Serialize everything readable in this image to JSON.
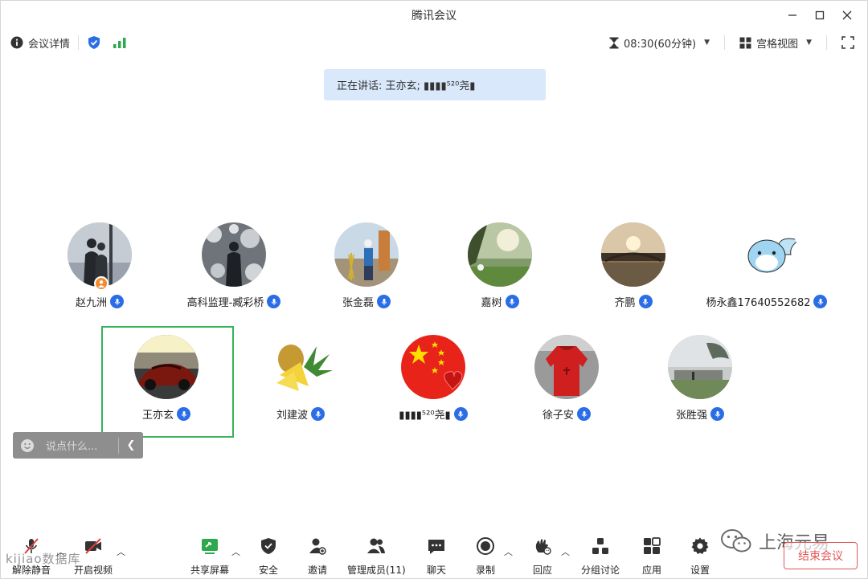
{
  "window": {
    "title": "腾讯会议"
  },
  "infobar": {
    "details_label": "会议详情",
    "timer": "08:30(60分钟)",
    "view_label": "宫格视图"
  },
  "speaking": {
    "text": "正在讲话: 王亦玄; ▮▮▮▮⁵²⁰尧▮"
  },
  "participants": [
    {
      "name": "赵九洲"
    },
    {
      "name": "高科监理-臧彩桥"
    },
    {
      "name": "张金磊"
    },
    {
      "name": "嘉树"
    },
    {
      "name": "齐鹏"
    },
    {
      "name": "杨永鑫17640552682"
    },
    {
      "name": "王亦玄"
    },
    {
      "name": "刘建波"
    },
    {
      "name": "▮▮▮▮⁵²⁰尧▮"
    },
    {
      "name": "徐子安"
    },
    {
      "name": "张胜强"
    }
  ],
  "chat": {
    "placeholder": "说点什么..."
  },
  "toolbar": {
    "unmute": "解除静音",
    "video": "开启视频",
    "share": "共享屏幕",
    "security": "安全",
    "invite": "邀请",
    "members": "管理成员(11)",
    "chat": "聊天",
    "record": "录制",
    "reaction": "回应",
    "breakout": "分组讨论",
    "apps": "应用",
    "settings": "设置",
    "end": "结束会议"
  },
  "watermark": {
    "left": "kijiao数据库",
    "brand": "上海元易"
  },
  "colors": {
    "accent": "#2b6de6",
    "active_border": "#37b35a",
    "end_red": "#e45656",
    "banner_bg": "#d9e8fb"
  }
}
